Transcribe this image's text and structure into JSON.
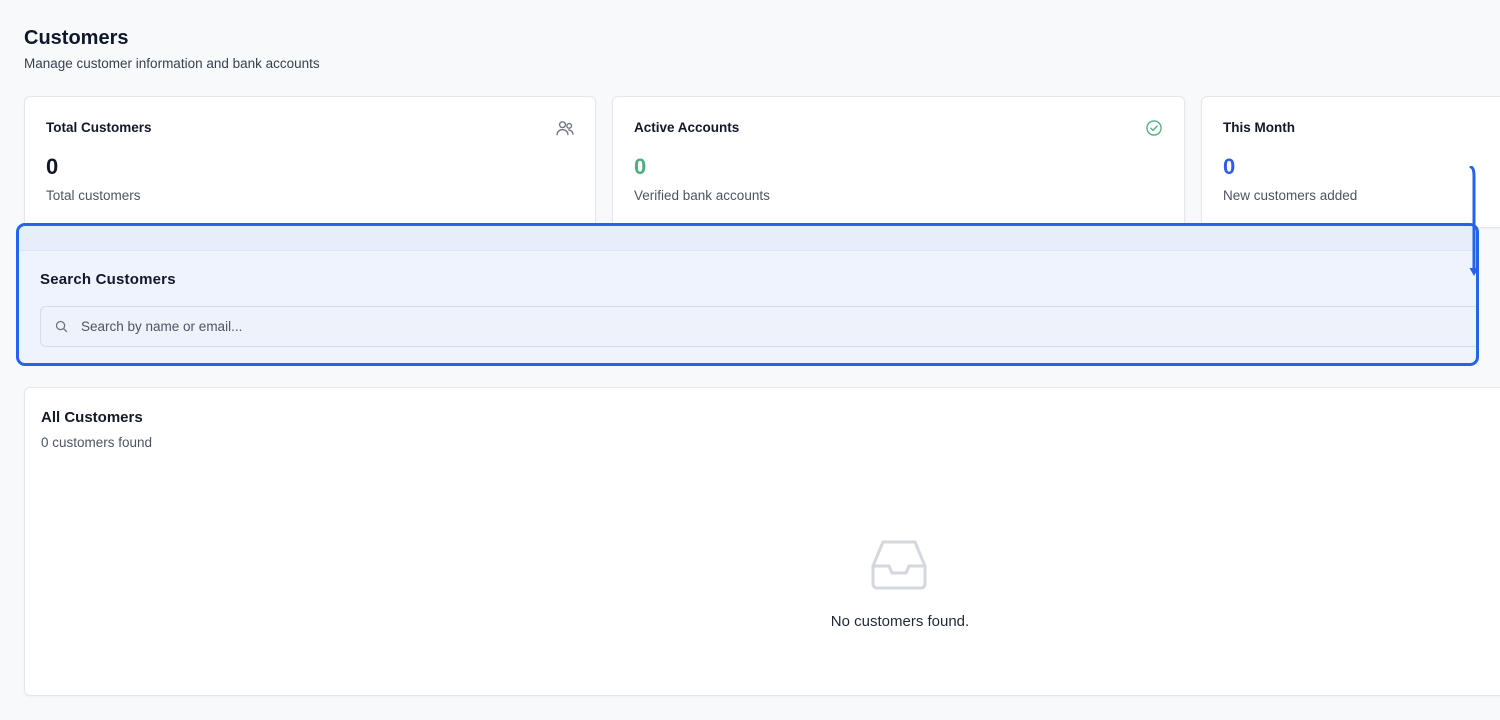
{
  "header": {
    "title": "Customers",
    "subtitle": "Manage customer information and bank accounts"
  },
  "stats": [
    {
      "title": "Total Customers",
      "value": "0",
      "description": "Total customers",
      "icon": "users-icon",
      "value_color": "#111827"
    },
    {
      "title": "Active Accounts",
      "value": "0",
      "description": "Verified bank accounts",
      "icon": "check-circle-icon",
      "value_color": "#4caf7d"
    },
    {
      "title": "This Month",
      "value": "0",
      "description": "New customers added",
      "icon": "",
      "value_color": "#2f5bea"
    }
  ],
  "search": {
    "title": "Search Customers",
    "placeholder": "Search by name or email...",
    "value": ""
  },
  "customers": {
    "title": "All Customers",
    "count_label": "0 customers found",
    "empty_message": "No customers found."
  },
  "colors": {
    "accent": "#2563eb",
    "success": "#4caf7d",
    "info": "#2f5bea"
  }
}
